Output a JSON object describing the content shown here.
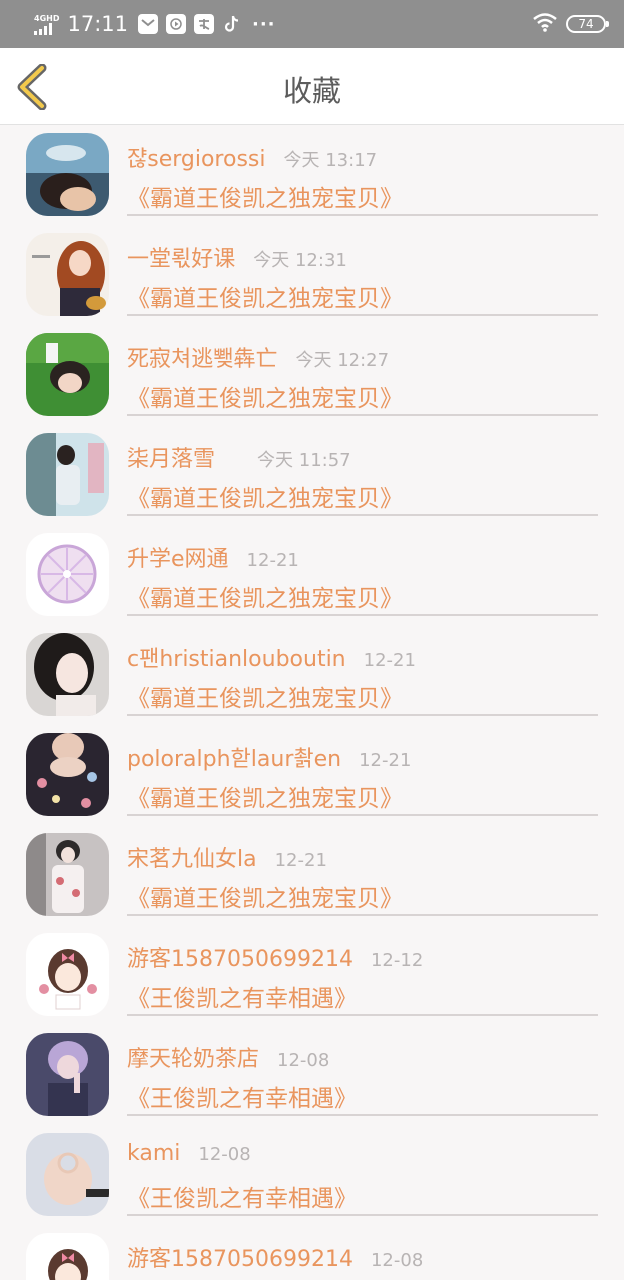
{
  "status_bar": {
    "network": "4GHD",
    "time": "17:11",
    "more": "···",
    "battery": "74"
  },
  "header": {
    "title": "收藏"
  },
  "items": [
    {
      "username": "쟎sergiorossi",
      "time": "今天 13:17",
      "book": "《霸道王俊凯之独宠宝贝》"
    },
    {
      "username": "一堂뢳好课",
      "time": "今天 12:31",
      "book": "《霸道王俊凯之独宠宝贝》"
    },
    {
      "username": "死寂쳐逃뾎犇亡",
      "time": "今天 12:27",
      "book": "《霸道王俊凯之独宠宝贝》"
    },
    {
      "username": "柒月落雪",
      "time": "今天 11:57",
      "book": "《霸道王俊凯之独宠宝贝》"
    },
    {
      "username": "升学e网通",
      "time": "12-21",
      "book": "《霸道王俊凯之独宠宝贝》"
    },
    {
      "username": "c팬hristianlouboutin",
      "time": "12-21",
      "book": "《霸道王俊凯之独宠宝贝》"
    },
    {
      "username": "poloralph핟laur촭en",
      "time": "12-21",
      "book": "《霸道王俊凯之独宠宝贝》"
    },
    {
      "username": "宋茗九仙女la",
      "time": "12-21",
      "book": "《霸道王俊凯之独宠宝贝》"
    },
    {
      "username": "游客1587050699214",
      "time": "12-12",
      "book": "《王俊凯之有幸相遇》"
    },
    {
      "username": "摩天轮奶茶店",
      "time": "12-08",
      "book": "《王俊凯之有幸相遇》"
    },
    {
      "username": "kami",
      "time": "12-08",
      "book": "《王俊凯之有幸相遇》"
    },
    {
      "username": "游客1587050699214",
      "time": "12-08",
      "book": ""
    }
  ]
}
